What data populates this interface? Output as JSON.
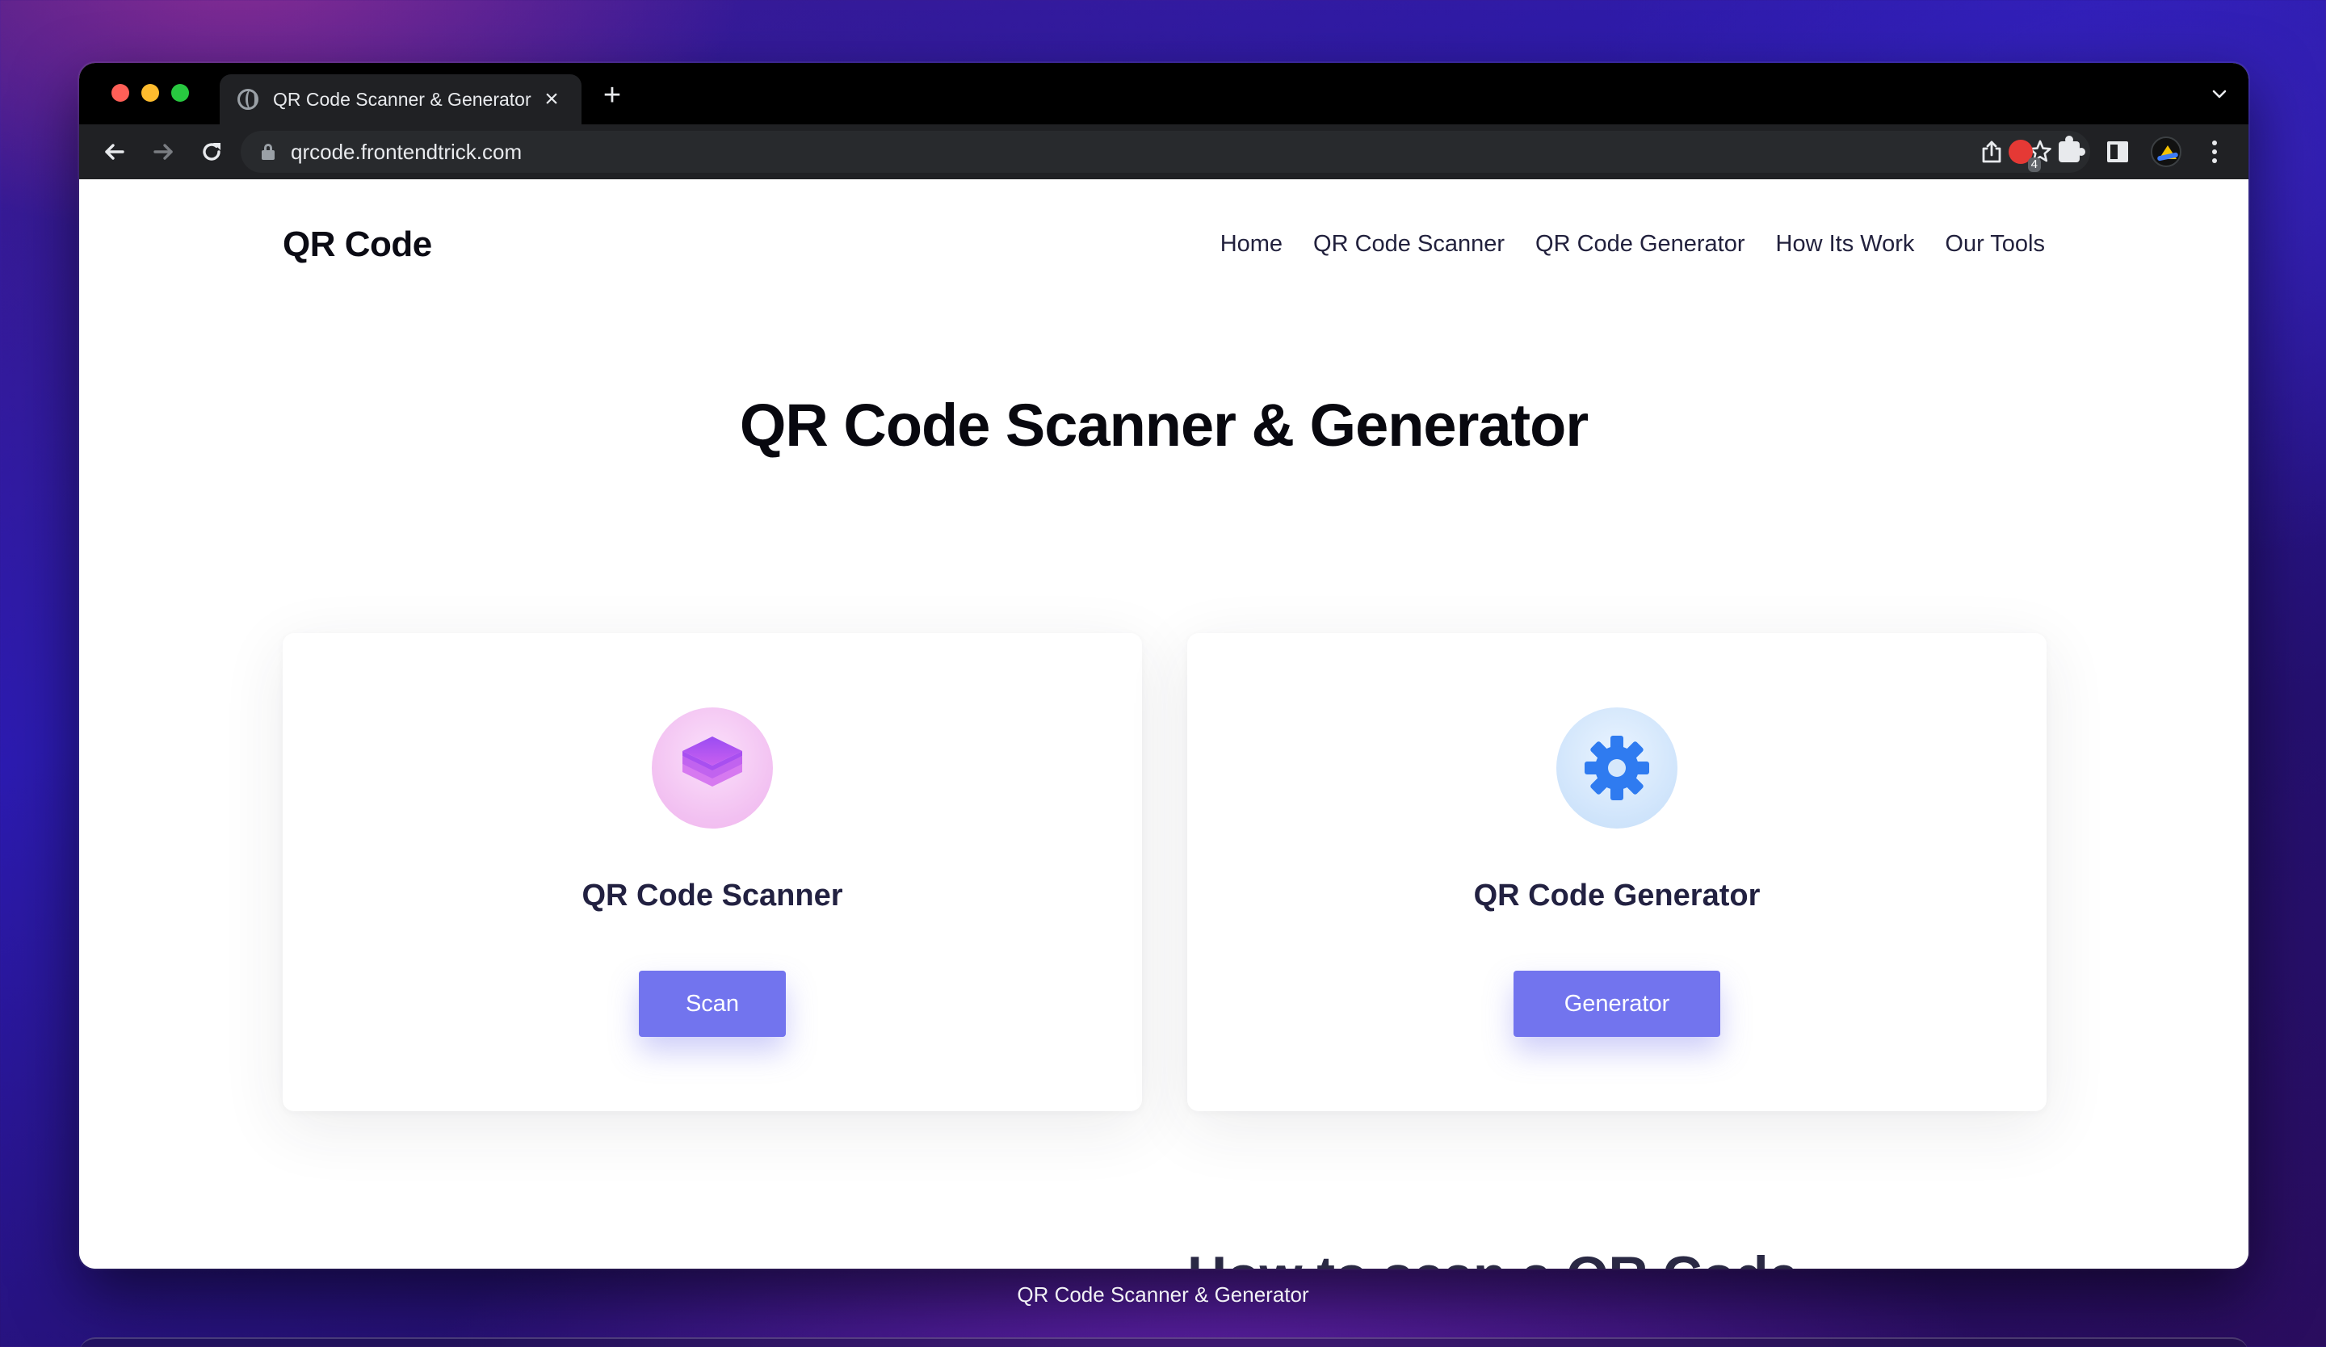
{
  "browser": {
    "tab_title": "QR Code Scanner & Generator",
    "url": "qrcode.frontendtrick.com",
    "extension_badge": "4"
  },
  "site": {
    "logo": "QR Code",
    "nav": [
      "Home",
      "QR Code Scanner",
      "QR Code Generator",
      "How Its Work",
      "Our Tools"
    ],
    "hero_title": "QR Code Scanner & Generator",
    "cards": [
      {
        "title": "QR Code Scanner",
        "button": "Scan",
        "icon": "layers-icon",
        "icon_color": "#a64ff0"
      },
      {
        "title": "QR Code Generator",
        "button": "Generator",
        "icon": "gear-icon",
        "icon_color": "#2f7bf0"
      }
    ],
    "section_heading": "How to scan a QR Code from picture"
  },
  "window_label": "QR Code Scanner & Generator",
  "colors": {
    "accent": "#7274ee",
    "heading": "#222141"
  }
}
